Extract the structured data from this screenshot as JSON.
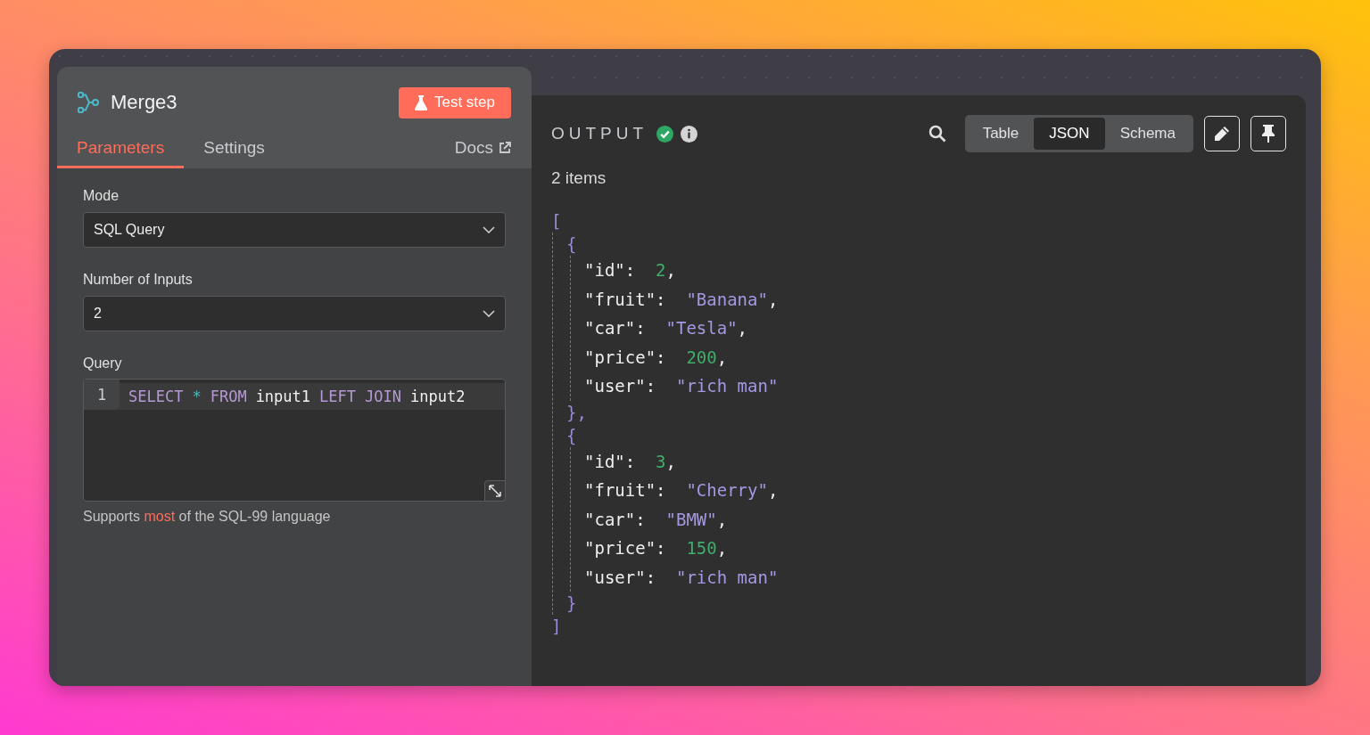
{
  "node": {
    "title": "Merge3",
    "test_button": "Test step",
    "tabs": [
      {
        "label": "Parameters",
        "selected": true
      },
      {
        "label": "Settings",
        "selected": false
      }
    ],
    "docs_link": "Docs",
    "parameters": [
      {
        "kind": "select",
        "label": "Mode",
        "value": "SQL Query"
      },
      {
        "kind": "select",
        "label": "Number of Inputs",
        "value": "2"
      },
      {
        "kind": "code",
        "label": "Query",
        "line_number": "1",
        "tokens": [
          {
            "text": "SELECT",
            "kind": "keyword"
          },
          {
            "text": "*",
            "kind": "operator"
          },
          {
            "text": "FROM",
            "kind": "keyword"
          },
          {
            "text": "input1",
            "kind": "name"
          },
          {
            "text": "LEFT",
            "kind": "keyword"
          },
          {
            "text": "JOIN",
            "kind": "keyword"
          },
          {
            "text": "input2",
            "kind": "name"
          }
        ],
        "hint": "Supports **most** of the SQL-99 language"
      }
    ]
  },
  "output": {
    "title": "OUTPUT",
    "succeeded": true,
    "views": [
      {
        "label": "Table",
        "selected": false
      },
      {
        "label": "JSON",
        "selected": true
      },
      {
        "label": "Schema",
        "selected": false
      }
    ],
    "count": "2 items",
    "json": {
      "open": "[",
      "close": "]",
      "items": [
        {
          "open": "{",
          "close": "},",
          "fields": [
            {
              "key": "\"id\":",
              "value": "2",
              "kind": "number",
              "comma": ","
            },
            {
              "key": "\"fruit\":",
              "value": "\"Banana\"",
              "kind": "string",
              "comma": ","
            },
            {
              "key": "\"car\":",
              "value": "\"Tesla\"",
              "kind": "string",
              "comma": ","
            },
            {
              "key": "\"price\":",
              "value": "200",
              "kind": "number",
              "comma": ","
            },
            {
              "key": "\"user\":",
              "value": "\"rich man\"",
              "kind": "string"
            }
          ]
        },
        {
          "open": "{",
          "close": "}",
          "fields": [
            {
              "key": "\"id\":",
              "value": "3",
              "kind": "number",
              "comma": ","
            },
            {
              "key": "\"fruit\":",
              "value": "\"Cherry\"",
              "kind": "string",
              "comma": ","
            },
            {
              "key": "\"car\":",
              "value": "\"BMW\"",
              "kind": "string",
              "comma": ","
            },
            {
              "key": "\"price\":",
              "value": "150",
              "kind": "number",
              "comma": ","
            },
            {
              "key": "\"user\":",
              "value": "\"rich man\"",
              "kind": "string"
            }
          ]
        }
      ]
    }
  }
}
